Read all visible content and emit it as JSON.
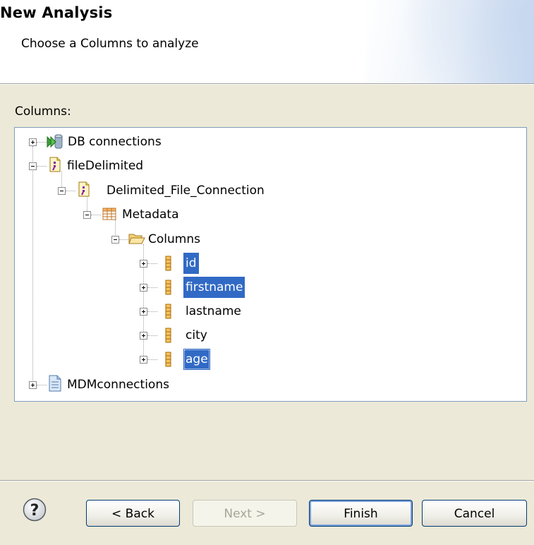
{
  "header": {
    "title": "New Analysis",
    "subtitle": "Choose a Columns to analyze"
  },
  "columns_label": "Columns:",
  "tree": {
    "nodes": [
      {
        "label": "DB connections",
        "icon": "db-connections-icon",
        "expanded": false
      },
      {
        "label": "fileDelimited",
        "icon": "file-delimited-icon",
        "expanded": true
      },
      {
        "label": "Delimited_File_Connection",
        "icon": "file-connection-icon",
        "expanded": true
      },
      {
        "label": "Metadata",
        "icon": "table-icon",
        "expanded": true
      },
      {
        "label": "Columns",
        "icon": "folder-open-icon",
        "expanded": true
      },
      {
        "label": "id",
        "icon": "column-icon",
        "expanded": false,
        "selected": true
      },
      {
        "label": "firstname",
        "icon": "column-icon",
        "expanded": false,
        "selected": true
      },
      {
        "label": "lastname",
        "icon": "column-icon",
        "expanded": false,
        "selected": false
      },
      {
        "label": "city",
        "icon": "column-icon",
        "expanded": false,
        "selected": false
      },
      {
        "label": "age",
        "icon": "column-icon",
        "expanded": false,
        "selected": true
      },
      {
        "label": "MDMconnections",
        "icon": "mdm-document-icon",
        "expanded": false
      }
    ]
  },
  "buttons": {
    "help": "help-icon",
    "back": "< Back",
    "next": "Next >",
    "finish": "Finish",
    "cancel": "Cancel"
  },
  "colors": {
    "selection": "#316ac5",
    "dialog_bg": "#ece9d8",
    "column_icon": "#d28a1e"
  }
}
